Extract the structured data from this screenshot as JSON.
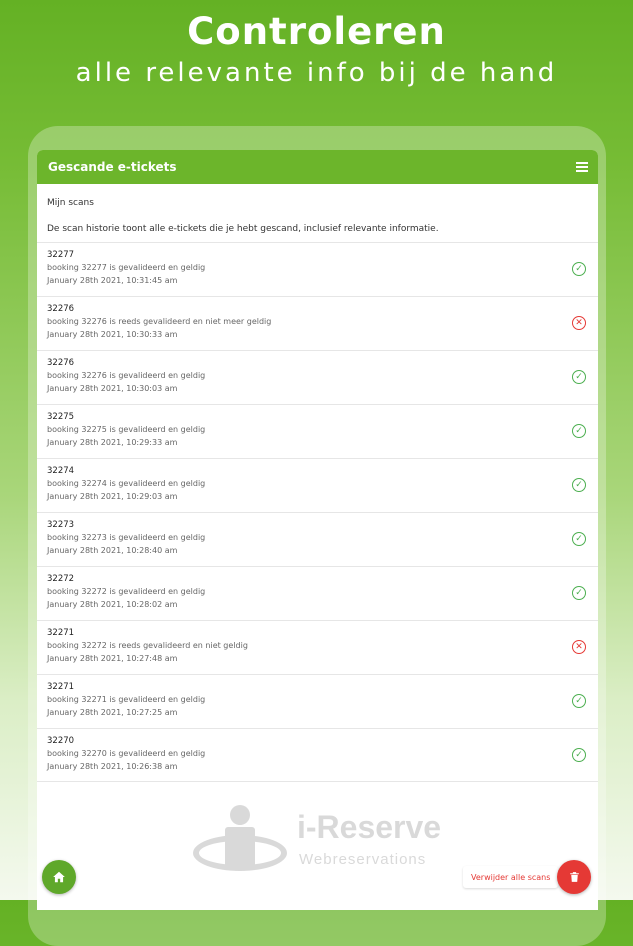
{
  "hero": {
    "title": "Controleren",
    "subtitle": "alle relevante info bij de hand"
  },
  "app_bar": {
    "title": "Gescande e-tickets",
    "menu_icon": "hamburger-menu-icon"
  },
  "scans_section": {
    "title": "Mijn scans",
    "description": "De scan historie toont alle e-tickets die je hebt gescand, inclusief relevante informatie."
  },
  "scans": [
    {
      "id": "32277",
      "message": "booking 32277 is gevalideerd en geldig",
      "time": "January 28th 2021, 10:31:45 am",
      "status": "valid"
    },
    {
      "id": "32276",
      "message": "booking 32276 is reeds gevalideerd en niet meer geldig",
      "time": "January 28th 2021, 10:30:33 am",
      "status": "invalid"
    },
    {
      "id": "32276",
      "message": "booking 32276 is gevalideerd en geldig",
      "time": "January 28th 2021, 10:30:03 am",
      "status": "valid"
    },
    {
      "id": "32275",
      "message": "booking 32275 is gevalideerd en geldig",
      "time": "January 28th 2021, 10:29:33 am",
      "status": "valid"
    },
    {
      "id": "32274",
      "message": "booking 32274 is gevalideerd en geldig",
      "time": "January 28th 2021, 10:29:03 am",
      "status": "valid"
    },
    {
      "id": "32273",
      "message": "booking 32273 is gevalideerd en geldig",
      "time": "January 28th 2021, 10:28:40 am",
      "status": "valid"
    },
    {
      "id": "32272",
      "message": "booking 32272 is gevalideerd en geldig",
      "time": "January 28th 2021, 10:28:02 am",
      "status": "valid"
    },
    {
      "id": "32271",
      "message": "booking 32272 is reeds gevalideerd en niet geldig",
      "time": "January 28th 2021, 10:27:48 am",
      "status": "invalid"
    },
    {
      "id": "32271",
      "message": "booking 32271 is gevalideerd en geldig",
      "time": "January 28th 2021, 10:27:25 am",
      "status": "valid"
    },
    {
      "id": "32270",
      "message": "booking 32270 is gevalideerd en geldig",
      "time": "January 28th 2021, 10:26:38 am",
      "status": "valid"
    }
  ],
  "status_icons": {
    "valid": "check-circle-icon",
    "invalid": "x-circle-icon"
  },
  "watermark": {
    "brand": "i-Reserve",
    "tagline": "Webreservations"
  },
  "actions": {
    "home_icon": "home-icon",
    "delete_all_label": "Verwijder alle scans",
    "delete_icon": "trash-icon"
  },
  "colors": {
    "primary": "#6cb52b",
    "valid": "#4caf50",
    "invalid": "#e53935"
  }
}
